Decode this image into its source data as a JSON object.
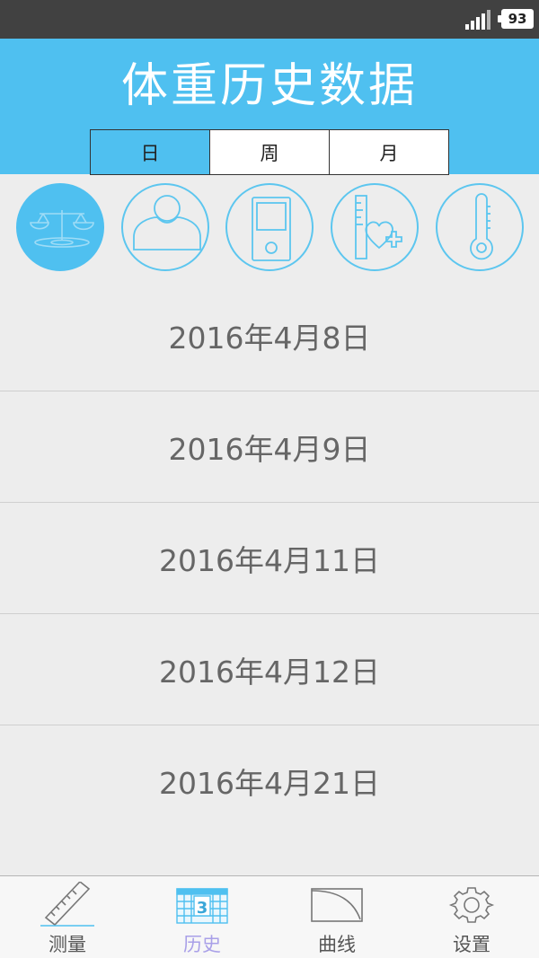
{
  "status_bar": {
    "battery": "93"
  },
  "header": {
    "title": "体重历史数据"
  },
  "segments": [
    {
      "label": "日",
      "active": true
    },
    {
      "label": "周",
      "active": false
    },
    {
      "label": "月",
      "active": false
    }
  ],
  "categories": [
    {
      "icon": "scale-icon",
      "active": true
    },
    {
      "icon": "person-icon",
      "active": false
    },
    {
      "icon": "device-icon",
      "active": false
    },
    {
      "icon": "height-heart-icon",
      "active": false
    },
    {
      "icon": "thermometer-icon",
      "active": false
    }
  ],
  "dates": [
    "2016年4月8日",
    "2016年4月9日",
    "2016年4月11日",
    "2016年4月12日",
    "2016年4月21日"
  ],
  "tabs": [
    {
      "label": "测量",
      "icon": "ruler-icon",
      "active": false
    },
    {
      "label": "历史",
      "icon": "calendar-icon",
      "active": true,
      "badge": "3"
    },
    {
      "label": "曲线",
      "icon": "curve-chart-icon",
      "active": false
    },
    {
      "label": "设置",
      "icon": "gear-icon",
      "active": false
    }
  ],
  "colors": {
    "header": "#4fc0f0",
    "accent_tab": "#a9a0e8",
    "icon_outline": "#5cc6ef"
  }
}
